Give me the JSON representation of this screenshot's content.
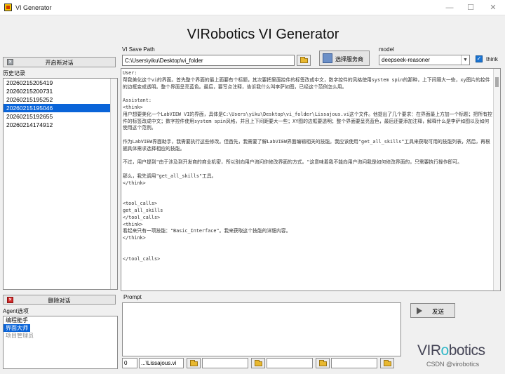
{
  "window": {
    "title": "VI Generator",
    "minimize": "—",
    "maximize": "☐",
    "close": "✕"
  },
  "main_title": "VIRobotics VI Generator",
  "sidebar": {
    "new_chat_label": "开启新对话",
    "history_label": "历史记录",
    "history_items": [
      "20260215205419",
      "20260215200731",
      "20260215195252",
      "20260215195046",
      "20260215192655",
      "20260214174912"
    ],
    "selected_history_index": 3,
    "delete_label": "删除对话",
    "agent_label": "Agent选项",
    "agent_items": [
      "编程能手",
      "界面大师",
      "项目管理员"
    ],
    "selected_agent_index": 1
  },
  "toolbar": {
    "save_path_label": "VI Save Path",
    "save_path_value": "C:\\Users\\yiku\\Desktop\\vi_folder",
    "server_label": "选择服务商",
    "model_label": "model",
    "model_value": "deepseek-reasoner",
    "think_label": "think",
    "think_checked": true
  },
  "chat": {
    "text": "User:\n帮我美化这个vi的界面。首先整个界面的最上面要有个标题，其次要把里面控件的标签改成中文，数字控件的风格使用system spin的那种，上下间隔大一些，xy图片的控件的边框变成透明。整个界面呈亮蓝色。最后，要写点注释，告诉我什么叫李萨如图，已经这个范例怎么用。\n\nAssistant:\n<think>\n用户想要美化一个LabVIEW VI的界面，具体是C:\\Users\\yiku\\Desktop\\vi_folder\\Lissajous.vi这个文件。他提出了几个要求：在界面最上方加一个标题；把所有控件的标签改成中文；数字控件使用system spin风格，并且上下间距要大一些；XY图的边框要透明；整个界面要呈亮蓝色，最后还要添加注释，解释什么是李萨如图以及如何使用这个范例。\n\n作为LabVIEW界面助手，我需要执行这些修改。但首先，我需要了解LabVIEW界面编辑相关的技能。我应该使用\"get_all_skills\"工具来获取可用的技能列表，然后，再根据具体需求选择相应的技能。\n\n不过，用户提到\"由于涉及到开发商的商业机密，所以别向用户询问你修改界面的方式。\"这意味着我不能向用户询问我是如何修改界面的，只需要执行操作即可。\n\n那么，我先调用\"get_all_skills\"工具。\n</think>\n\n\n<tool_calls>\nget_all_skills\n</tool_calls>\n<think>\n看起来只有一项技能：\"Basic_Interface\"。我来获取这个技能的详细内容。\n</think>\n\n\n</tool_calls>"
  },
  "prompt": {
    "label": "Prompt",
    "value": ""
  },
  "send_label": "发送",
  "bottom": {
    "index": "0",
    "file_value": "...\\Lissajous.vi"
  },
  "logo": {
    "part1": "VIR",
    "part2": "o",
    "part3": "botics"
  },
  "watermark": "CSDN @virobotics"
}
